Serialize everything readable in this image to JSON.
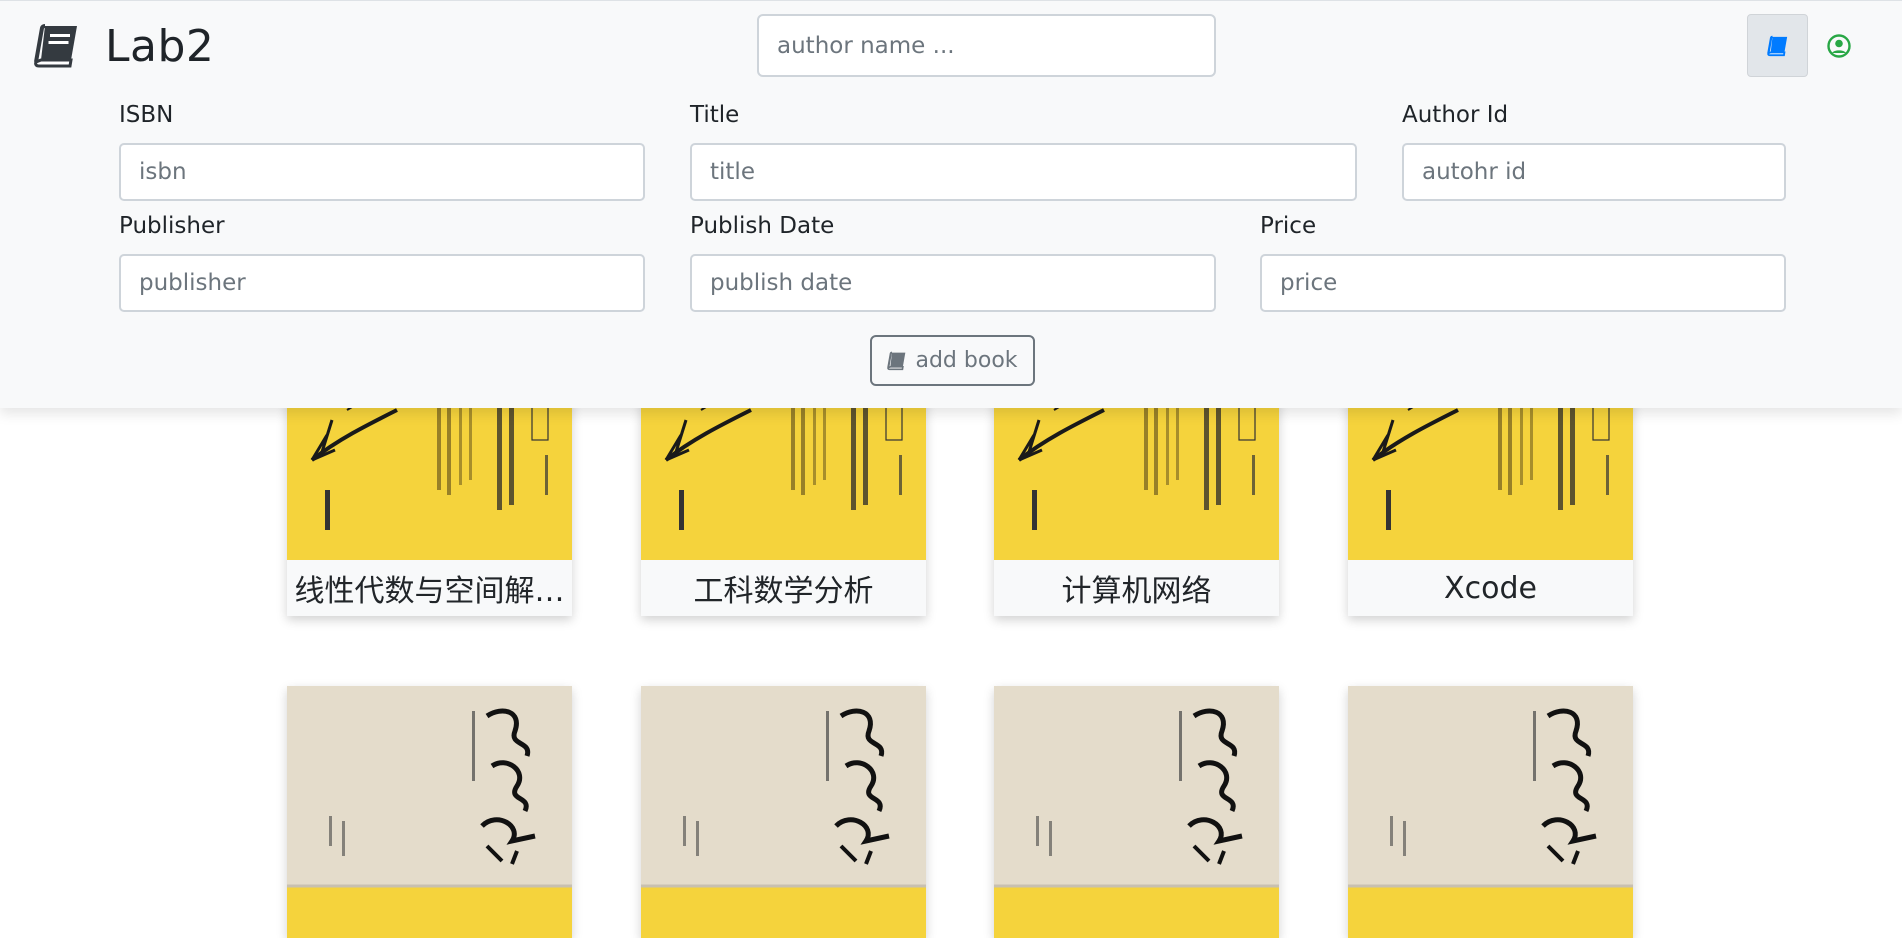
{
  "app": {
    "brand": "Lab2"
  },
  "search": {
    "placeholder": "author name ..."
  },
  "form": {
    "isbn": {
      "label": "ISBN",
      "placeholder": "isbn"
    },
    "title": {
      "label": "Title",
      "placeholder": "title"
    },
    "author_id": {
      "label": "Author Id",
      "placeholder": "autohr id"
    },
    "publisher": {
      "label": "Publisher",
      "placeholder": "publisher"
    },
    "publish_date": {
      "label": "Publish Date",
      "placeholder": "publish date"
    },
    "price": {
      "label": "Price",
      "placeholder": "price"
    },
    "add_button": "add book"
  },
  "icons": {
    "brand": "book-icon",
    "books_nav": "book-icon",
    "user_nav": "user-circle-icon"
  },
  "colors": {
    "accent": "#007bff",
    "success": "#28a745",
    "secondary": "#6c757d",
    "cover_yellow": "#f5d33c",
    "cover_beige": "#e4dccb"
  },
  "books_row1": [
    {
      "title": "线性代数与空间解…"
    },
    {
      "title": "工科数学分析"
    },
    {
      "title": "计算机网络"
    },
    {
      "title": "Xcode"
    }
  ],
  "books_row2_count_visible": 4
}
